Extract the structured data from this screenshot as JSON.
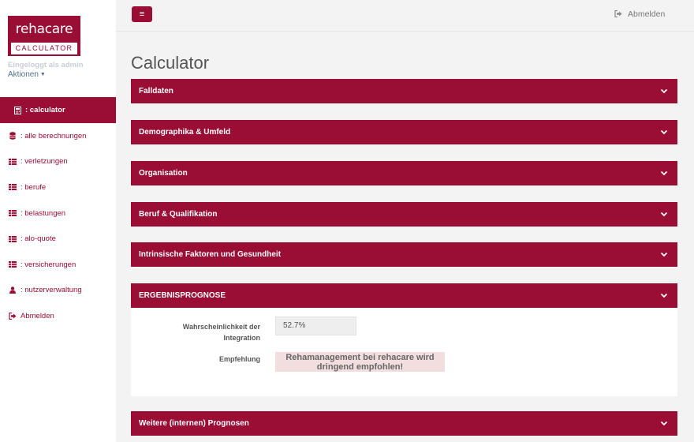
{
  "brand": {
    "name": "rehacare",
    "tagline": "CALCULATOR"
  },
  "user": {
    "status": "Eingeloggt als admin",
    "actions_label": "Aktionen"
  },
  "sidebar": {
    "items": [
      {
        "label": ": calculator",
        "icon": "calculator-icon",
        "active": true
      },
      {
        "label": ": alle berechnungen",
        "icon": "database-icon"
      },
      {
        "label": ": verletzungen",
        "icon": "table-icon"
      },
      {
        "label": ": berufe",
        "icon": "table-icon"
      },
      {
        "label": ": belastungen",
        "icon": "table-icon"
      },
      {
        "label": ": alo-quote",
        "icon": "table-icon"
      },
      {
        "label": ": versicherungen",
        "icon": "table-icon"
      },
      {
        "label": ": nutzerverwaltung",
        "icon": "user-icon"
      },
      {
        "label": "Abmelden",
        "icon": "sign-out-icon"
      }
    ]
  },
  "topbar": {
    "menu_icon": "≡",
    "logout_label": "Abmelden"
  },
  "page": {
    "title": "Calculator"
  },
  "panels": [
    {
      "label": "Falldaten"
    },
    {
      "label": "Demographika & Umfeld"
    },
    {
      "label": "Organisation"
    },
    {
      "label": "Beruf & Qualifikation"
    },
    {
      "label": "Intrinsische Faktoren und Gesundheit"
    },
    {
      "label": "ERGEBNISPROGNOSE"
    },
    {
      "label": "Weitere (internen) Prognosen"
    }
  ],
  "result": {
    "probability_label_line1": "Wahrscheinlichkeit der",
    "probability_label_line2": "Integration",
    "probability_value": "52.7%",
    "recommendation_label": "Empfehlung",
    "recommendation_line1": "Rehamanagement bei rehacare wird",
    "recommendation_line2": "dringend empfohlen!"
  },
  "colors": {
    "brand": "#9a0d34",
    "background": "#f3f3f4",
    "recommendation_bg": "#f2dede"
  }
}
